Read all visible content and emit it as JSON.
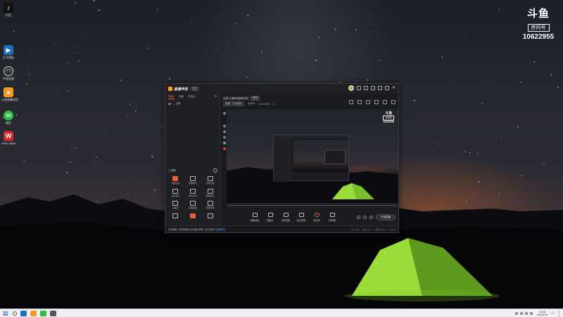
{
  "desktop": {
    "icons": [
      {
        "label": "抖音",
        "icon": "tiktok-icon",
        "color": "#111111"
      },
      {
        "label": "打开模板",
        "icon": "app-icon",
        "color": "#1e6fb8"
      },
      {
        "label": "中星加速",
        "icon": "speedometer-icon",
        "color": "#333333"
      },
      {
        "label": "斗鱼直播伴侣",
        "icon": "douyu-icon",
        "color": "#f59a23"
      },
      {
        "label": "微信",
        "icon": "wechat-icon",
        "color": "#2dbb45"
      },
      {
        "label": "WPS Office",
        "icon": "wps-icon",
        "color": "#d8262b"
      }
    ]
  },
  "room_badge": {
    "logo": "斗鱼",
    "label": "房间号",
    "number": "10622955"
  },
  "app": {
    "name": "直播伴侣",
    "version_chip": "测试",
    "left_panel": {
      "tabs": [
        "场景1",
        "场景",
        "开始后"
      ],
      "scene_item": "全屏",
      "toolbox_title": "工具箱",
      "tools": [
        {
          "label": "直播任务",
          "hot": true
        },
        {
          "label": "观看统计",
          "hot": false
        },
        {
          "label": "直播日程",
          "hot": false
        },
        {
          "label": "活动专区",
          "hot": false
        },
        {
          "label": "粉丝分析",
          "hot": false
        },
        {
          "label": "弹幕助手",
          "hot": false
        },
        {
          "label": "直播间",
          "hot": false
        },
        {
          "label": "直播回放",
          "hot": false
        },
        {
          "label": "弹幕管理",
          "hot": false
        },
        {
          "label": "",
          "hot": false
        },
        {
          "label": "",
          "hot": true
        },
        {
          "label": "",
          "hot": false
        }
      ]
    },
    "header": {
      "title": "玩家之夜的游戏时间",
      "modify_label": "修改",
      "category_chip": "直播 · 生活娱乐",
      "room_label": "房间号",
      "room_value": "10622955",
      "likes": "0"
    },
    "controls": [
      {
        "label": "直播设置",
        "icon": "settings-icon"
      },
      {
        "label": "摄像头",
        "icon": "camera-icon"
      },
      {
        "label": "游戏投屏",
        "icon": "screen-icon"
      },
      {
        "label": "窗口投屏",
        "icon": "window-icon"
      },
      {
        "label": "麦克风",
        "icon": "mic-icon"
      },
      {
        "label": "扬声器",
        "icon": "speaker-icon"
      }
    ],
    "start_live_label": "开始直播",
    "status": {
      "message": "礼物播报: 您的直播内容已通过审核, 请注意遵守",
      "link": "直播规范",
      "stats": [
        "CPU 8%",
        "内存 32%",
        "码率 0kb/s",
        "FPS 30"
      ]
    }
  },
  "taskbar": {
    "time": "23:05",
    "date": "2022/4/13",
    "colors": [
      "#1e6fb8",
      "#f59a23",
      "#2dbb45",
      "#555555"
    ]
  }
}
